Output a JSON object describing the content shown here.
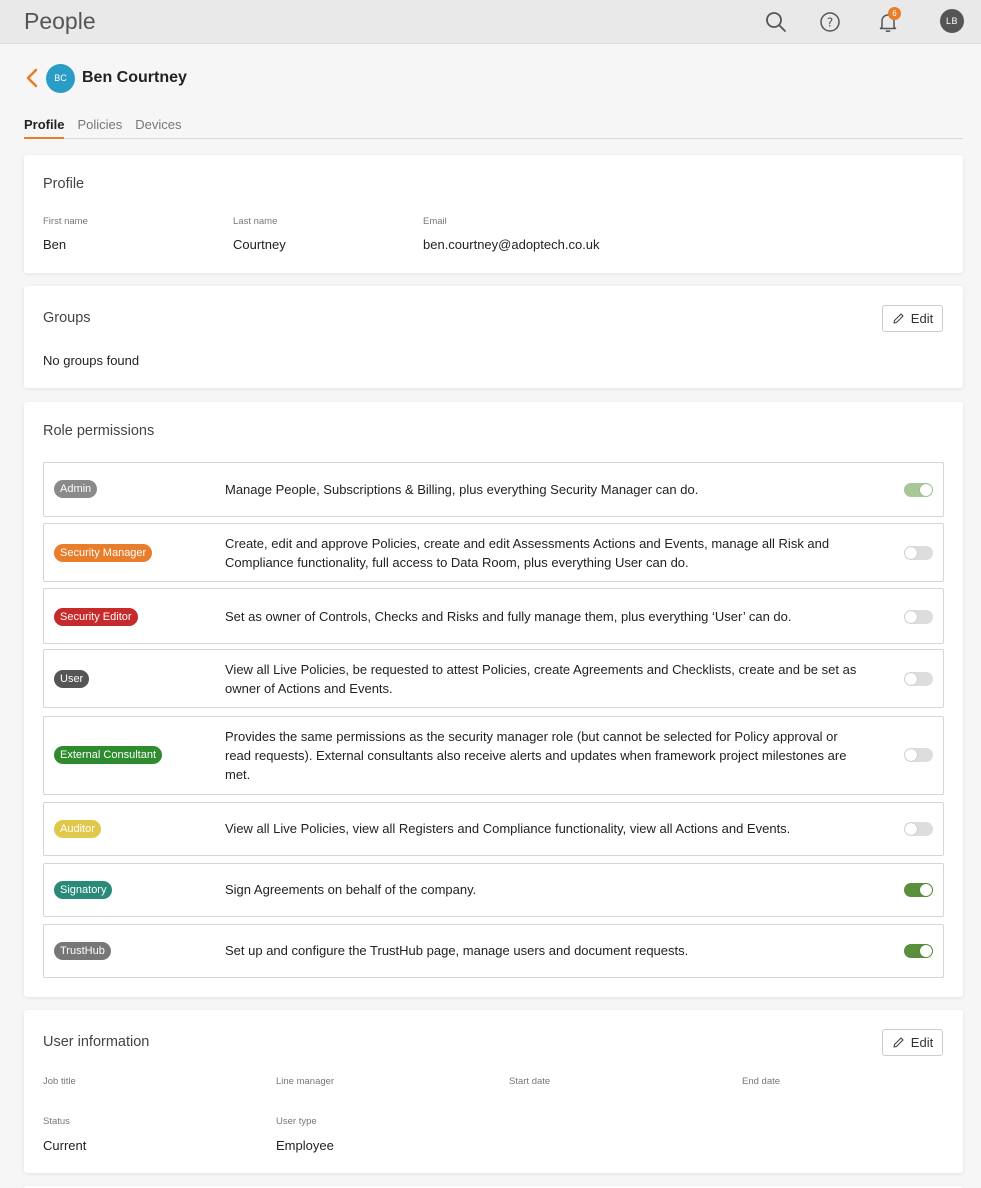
{
  "app": {
    "title": "People"
  },
  "topbar": {
    "notification_count": "6",
    "user_initials": "LB"
  },
  "user": {
    "initials": "BC",
    "name": "Ben Courtney"
  },
  "tabs": [
    {
      "label": "Profile",
      "active": true
    },
    {
      "label": "Policies",
      "active": false
    },
    {
      "label": "Devices",
      "active": false
    }
  ],
  "profile": {
    "title": "Profile",
    "first_name_label": "First name",
    "first_name": "Ben",
    "last_name_label": "Last name",
    "last_name": "Courtney",
    "email_label": "Email",
    "email": "ben.courtney@adoptech.co.uk"
  },
  "groups": {
    "title": "Groups",
    "edit_label": "Edit",
    "empty_text": "No groups found"
  },
  "roles": {
    "title": "Role permissions",
    "items": [
      {
        "name": "Admin",
        "color": "#8a8a8a",
        "description": "Manage People, Subscriptions & Billing, plus everything Security Manager can do.",
        "enabled": true,
        "disabled_control": true
      },
      {
        "name": "Security Manager",
        "color": "#e87d2b",
        "description": "Create, edit and approve Policies, create and edit Assessments Actions and Events, manage all Risk and Compliance functionality, full access to Data Room, plus everything User can do.",
        "enabled": false
      },
      {
        "name": "Security Editor",
        "color": "#c62a2a",
        "description": "Set as owner of Controls, Checks and Risks and fully manage them, plus everything ‘User’ can do.",
        "enabled": false
      },
      {
        "name": "User",
        "color": "#555555",
        "description": "View all Live Policies, be requested to attest Policies, create Agreements and Checklists, create and be set as owner of Actions and Events.",
        "enabled": false
      },
      {
        "name": "External Consultant",
        "color": "#2e8b2e",
        "description": "Provides the same permissions as the security manager role (but cannot be selected for Policy approval or read requests). External consultants also receive alerts and updates when framework project milestones are met.",
        "enabled": false
      },
      {
        "name": "Auditor",
        "color": "#e0c84a",
        "description": "View all Live Policies, view all Registers and Compliance functionality, view all Actions and Events.",
        "enabled": false
      },
      {
        "name": "Signatory",
        "color": "#2a8a7a",
        "description": "Sign Agreements on behalf of the company.",
        "enabled": true
      },
      {
        "name": "TrustHub",
        "color": "#777777",
        "description": "Set up and configure the TrustHub page, manage users and document requests.",
        "enabled": true
      }
    ]
  },
  "user_info": {
    "title": "User information",
    "edit_label": "Edit",
    "job_title_label": "Job title",
    "job_title": "",
    "line_manager_label": "Line manager",
    "line_manager": "",
    "start_date_label": "Start date",
    "start_date": "",
    "end_date_label": "End date",
    "end_date": "",
    "status_label": "Status",
    "status": "Current",
    "user_type_label": "User type",
    "user_type": "Employee"
  },
  "colors": {
    "accent": "#e87d2b",
    "toggle_on": "#5a8f3c",
    "toggle_on_disabled": "#a8c796"
  }
}
